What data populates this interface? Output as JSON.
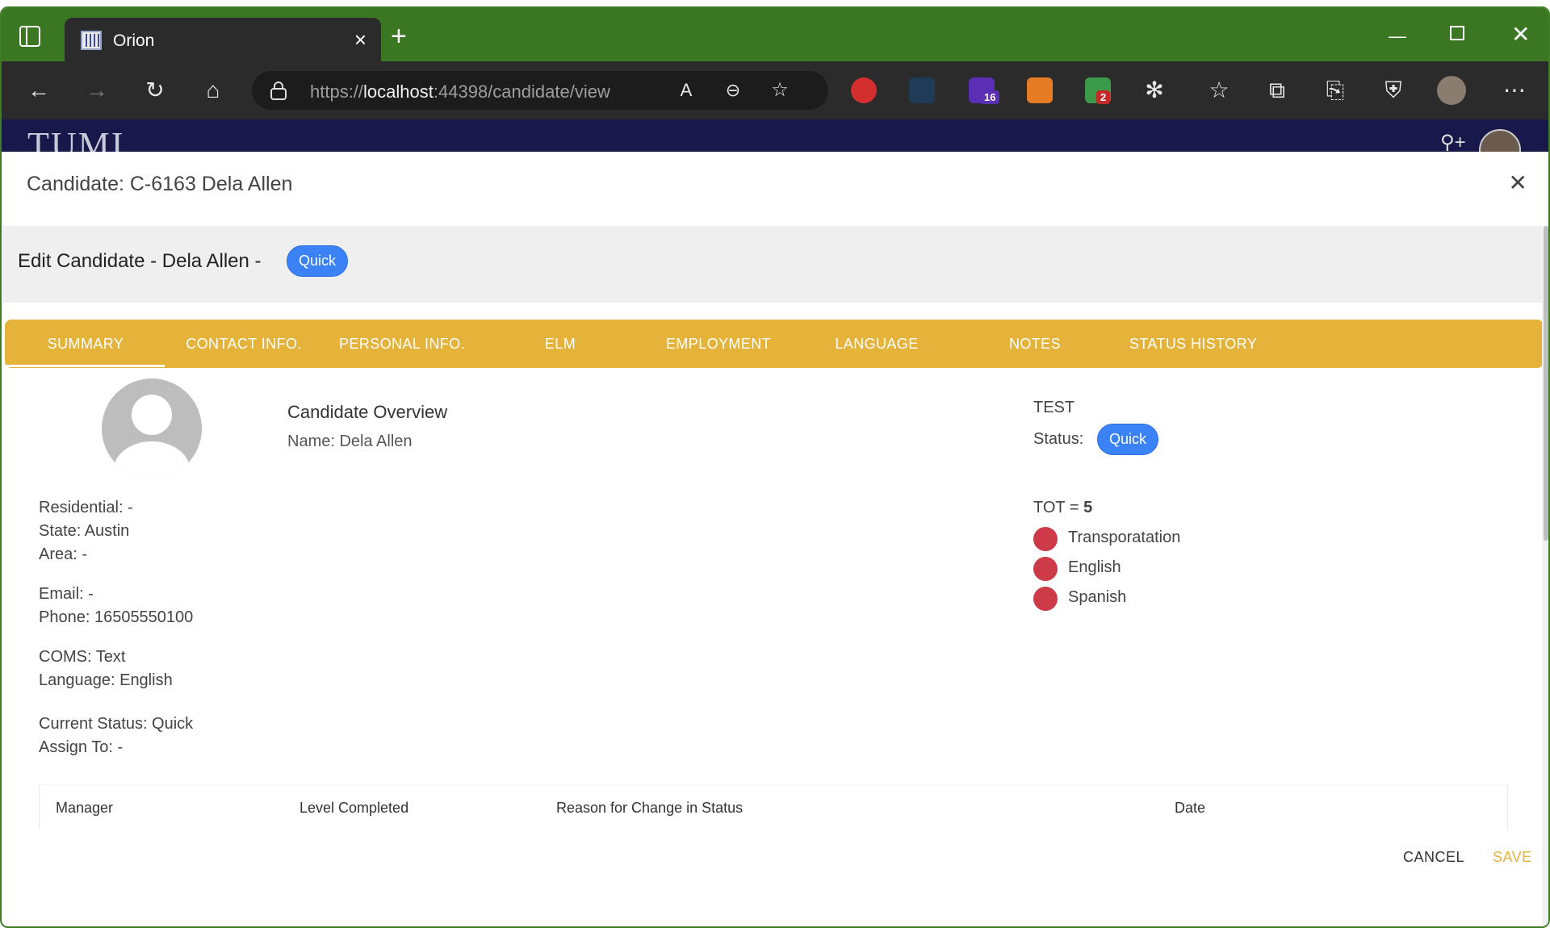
{
  "browser": {
    "tab_title": "Orion",
    "url_scheme": "https://",
    "url_host": "localhost",
    "url_rest": ":44398/candidate/view",
    "badges": {
      "ext_purple": "16",
      "ext_multicolor": "2"
    }
  },
  "app": {
    "logo": "TUMI"
  },
  "modal": {
    "title": "Candidate: C-6163 Dela Allen",
    "edit_label": "Edit Candidate - Dela Allen -",
    "edit_pill": "Quick",
    "tabs": [
      "SUMMARY",
      "CONTACT INFO.",
      "PERSONAL INFO.",
      "ELM",
      "EMPLOYMENT",
      "LANGUAGE",
      "NOTES",
      "STATUS HISTORY"
    ],
    "left_info": {
      "residential": "Residential: -",
      "state": "State: Austin",
      "area": "Area: -",
      "email": "Email: -",
      "phone": "Phone: 16505550100",
      "coms": "COMS: Text",
      "language": "Language: English",
      "current_status": "Current Status: Quick",
      "assign_to": "Assign To: -"
    },
    "overview": {
      "title": "Candidate Overview",
      "name": "Name: Dela Allen"
    },
    "right": {
      "test": "TEST",
      "status_label": "Status:",
      "status_value": "Quick",
      "tot_label": "TOT = ",
      "tot_value": "5",
      "items": [
        "Transporatation",
        "English",
        "Spanish"
      ],
      "dot_color": "#cc3b47"
    },
    "table_headers": [
      "Manager",
      "Level Completed",
      "Reason for Change in Status",
      "Date"
    ],
    "buttons": {
      "cancel": "CANCEL",
      "save": "SAVE"
    }
  },
  "colors": {
    "tabstrip": "#3b7722",
    "tabs_bar": "#e5b23a",
    "pill": "#3b82f6",
    "header_navy": "#18184a"
  }
}
